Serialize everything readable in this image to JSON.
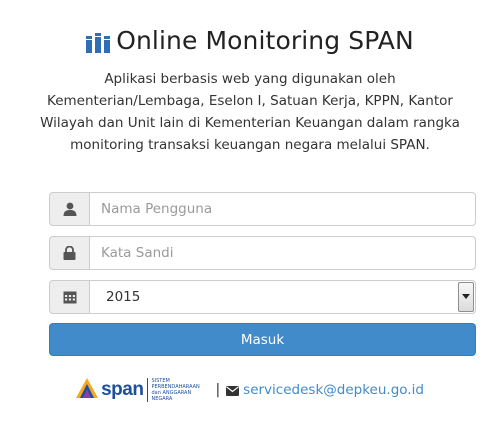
{
  "header": {
    "title": "Online Monitoring SPAN",
    "logo_icon": "building-columns-icon"
  },
  "description": "Aplikasi berbasis web yang digunakan oleh Kementerian/Lembaga, Eselon I, Satuan Kerja, KPPN, Kantor Wilayah dan Unit lain di Kementerian Keuangan dalam rangka monitoring transaksi keuangan negara melalui SPAN.",
  "form": {
    "username": {
      "placeholder": "Nama Pengguna",
      "value": "",
      "icon": "user-icon"
    },
    "password": {
      "placeholder": "Kata Sandi",
      "value": "",
      "icon": "lock-icon"
    },
    "year": {
      "selected": "2015",
      "icon": "calendar-icon"
    },
    "submit_label": "Masuk"
  },
  "footer": {
    "logo_word": "span",
    "logo_subtitle_1": "SISTEM PERBENDAHARAAN",
    "logo_subtitle_2": "dan ANGGARAN NEGARA",
    "separator": "|",
    "email": "servicedesk@depkeu.go.id",
    "email_icon": "envelope-icon"
  },
  "colors": {
    "primary": "#428bca",
    "addon_bg": "#eeeeee",
    "border": "#cccccc",
    "logo_blue": "#1c4f9c"
  }
}
